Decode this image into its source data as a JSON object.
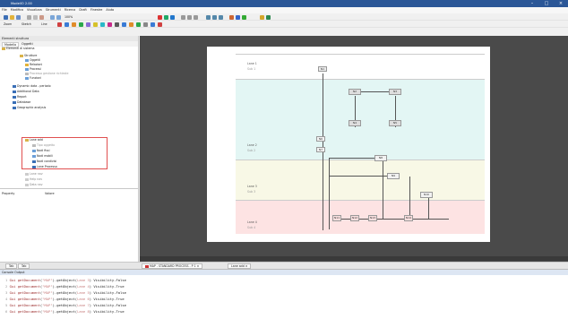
{
  "window": {
    "title": "ModelIO 2.00"
  },
  "menu": [
    "File",
    "Modifica",
    "Visualizza",
    "Strumenti",
    "Ricerca",
    "Draft",
    "Finestre",
    "Aiuto"
  ],
  "toolbar": {
    "zoom_label": "100%",
    "mode_label": "Zoom",
    "sketch_label": "Sketch",
    "line_label": "Line"
  },
  "left_panel": {
    "title": "Elementi struttura",
    "tabs": [
      "Modello",
      "Oggetti"
    ],
    "tree": [
      {
        "label": "Elementi di sistema",
        "level": 0
      },
      {
        "label": "Strutture",
        "level": 1
      },
      {
        "label": "Oggetti",
        "level": 2
      },
      {
        "label": "Relazioni",
        "level": 2
      },
      {
        "label": "Processi",
        "level": 2
      },
      {
        "label": "Processo gestione richieste",
        "level": 2
      },
      {
        "label": "Funzioni",
        "level": 2
      },
      {
        "label": "Dynamic data - periodo",
        "level": 1
      },
      {
        "label": "Additional Data",
        "level": 1
      },
      {
        "label": "Report",
        "level": 1
      },
      {
        "label": "Database",
        "level": 1
      },
      {
        "label": "Geographic analysis",
        "level": 1
      },
      {
        "label": "Lane add",
        "level": 1
      },
      {
        "label": "Tipo oggetto",
        "level": 2
      },
      {
        "label": "Nodi fissi",
        "level": 2
      },
      {
        "label": "Nodi mobili",
        "level": 2
      },
      {
        "label": "Nodi condivisi",
        "level": 2
      },
      {
        "label": "Lane Processo",
        "level": 2
      },
      {
        "label": "Lane nav",
        "level": 1
      },
      {
        "label": "Help nav",
        "level": 1
      },
      {
        "label": "Data nav",
        "level": 1
      },
      {
        "label": "Report nav",
        "level": 1
      }
    ],
    "properties_title": "Property",
    "properties_value": "Valore"
  },
  "diagram": {
    "lanes": [
      {
        "label": "Lane 1",
        "sub": "Sub 1",
        "color": "#ffffff"
      },
      {
        "label": "Lane 2",
        "sub": "Sub 2",
        "color": "#e3f6f4"
      },
      {
        "label": "Lane 3",
        "sub": "Sub 3",
        "color": "#f8f8e6"
      },
      {
        "label": "Lane 4",
        "sub": "Sub 4",
        "color": "#fde3e3"
      }
    ],
    "nodes": [
      "N1",
      "N2",
      "N3",
      "N4",
      "N5",
      "N6",
      "N7",
      "N8",
      "N9",
      "N10",
      "N11",
      "N12",
      "N13",
      "N14"
    ]
  },
  "tabs": {
    "left": [
      "Tab",
      "Tab"
    ],
    "doc1": "MAP - STANDARD PROCESS - P 1",
    "doc2": "Lane add"
  },
  "console": {
    "title": "Console Output",
    "lines": [
      {
        "num": "1",
        "obj": "Lane 3",
        "val": "Visibility-False"
      },
      {
        "num": "2",
        "obj": "Lane 4",
        "val": "Visibility-True"
      },
      {
        "num": "3",
        "obj": "Lane 5",
        "val": "Visibility-False"
      },
      {
        "num": "4",
        "obj": "Lane 6",
        "val": "Visibility-True"
      },
      {
        "num": "5",
        "obj": "Lane 7",
        "val": "Visibility-False"
      },
      {
        "num": "6",
        "obj": "Lane 8",
        "val": "Visibility-True"
      }
    ]
  },
  "colors": {
    "accent": "#2b5797",
    "highlight": "#e05050"
  }
}
